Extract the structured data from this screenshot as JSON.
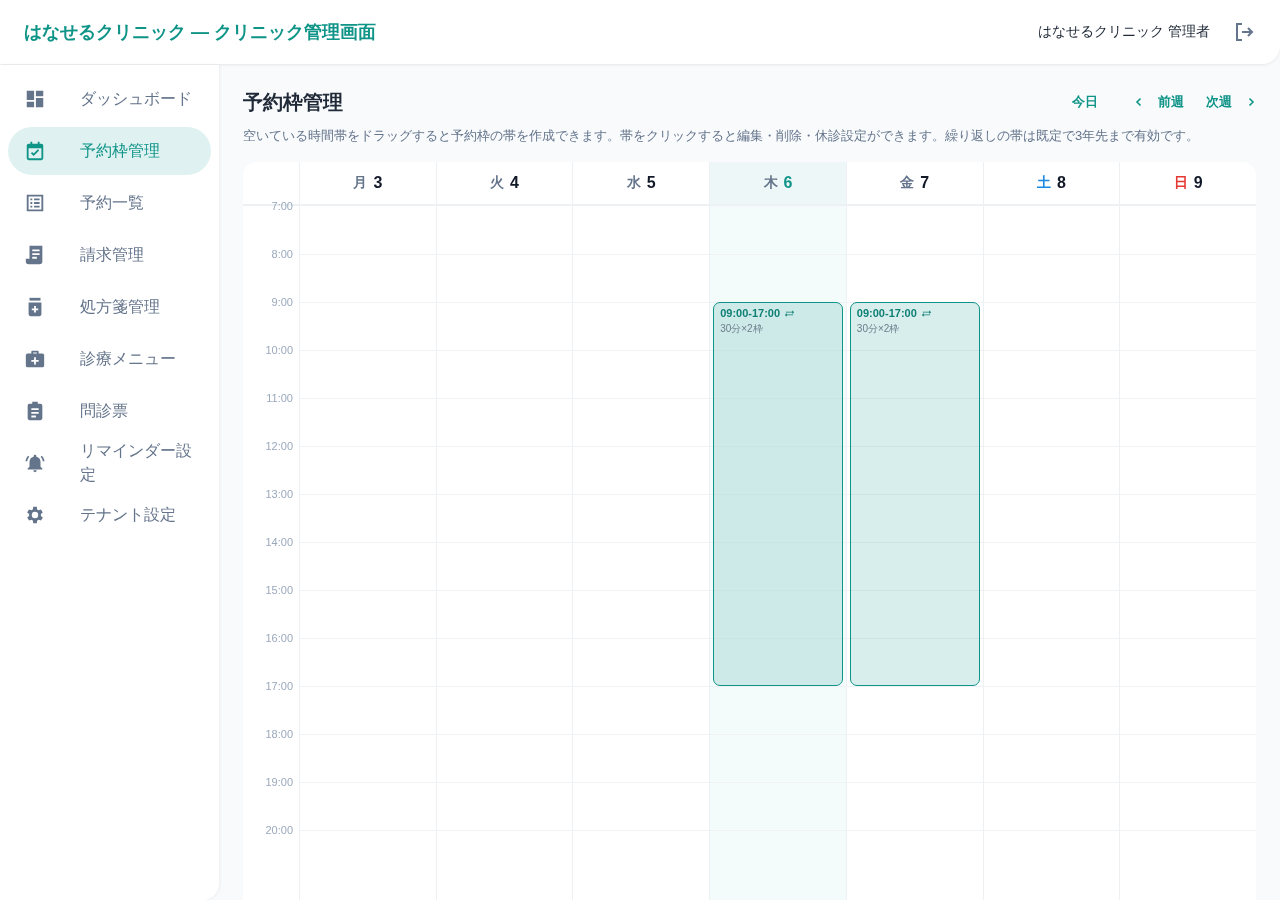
{
  "header": {
    "title": "はなせるクリニック — クリニック管理画面",
    "user": "はなせるクリニック 管理者"
  },
  "sidebar": {
    "items": [
      {
        "label": "ダッシュボード",
        "selected": false
      },
      {
        "label": "予約枠管理",
        "selected": true
      },
      {
        "label": "予約一覧",
        "selected": false
      },
      {
        "label": "請求管理",
        "selected": false
      },
      {
        "label": "処方箋管理",
        "selected": false
      },
      {
        "label": "診療メニュー",
        "selected": false
      },
      {
        "label": "問診票",
        "selected": false
      },
      {
        "label": "リマインダー設定",
        "selected": false
      },
      {
        "label": "テナント設定",
        "selected": false
      }
    ]
  },
  "page": {
    "title": "予約枠管理",
    "description": "空いている時間帯をドラッグすると予約枠の帯を作成できます。帯をクリックすると編集・削除・休診設定ができます。繰り返しの帯は既定で3年先まで有効です。",
    "nav": {
      "today": "今日",
      "prev": "前週",
      "next": "次週"
    }
  },
  "calendar": {
    "hours": [
      "7:00",
      "8:00",
      "9:00",
      "10:00",
      "11:00",
      "12:00",
      "13:00",
      "14:00",
      "15:00",
      "16:00",
      "17:00",
      "18:00",
      "19:00",
      "20:00"
    ],
    "days": [
      {
        "weekday": "月",
        "date": "3",
        "today": false,
        "color": "#64748b"
      },
      {
        "weekday": "火",
        "date": "4",
        "today": false,
        "color": "#64748b"
      },
      {
        "weekday": "水",
        "date": "5",
        "today": false,
        "color": "#64748b"
      },
      {
        "weekday": "木",
        "date": "6",
        "today": true,
        "color": "#64748b",
        "slots": [
          {
            "time": "09:00-17:00",
            "detail": "30分×2枠",
            "repeat": true
          }
        ]
      },
      {
        "weekday": "金",
        "date": "7",
        "today": false,
        "color": "#64748b",
        "slots": [
          {
            "time": "09:00-17:00",
            "detail": "30分×2枠",
            "repeat": true
          }
        ]
      },
      {
        "weekday": "土",
        "date": "8",
        "today": false,
        "color": "#1e88e5"
      },
      {
        "weekday": "日",
        "date": "9",
        "today": false,
        "color": "#e53935"
      }
    ]
  }
}
